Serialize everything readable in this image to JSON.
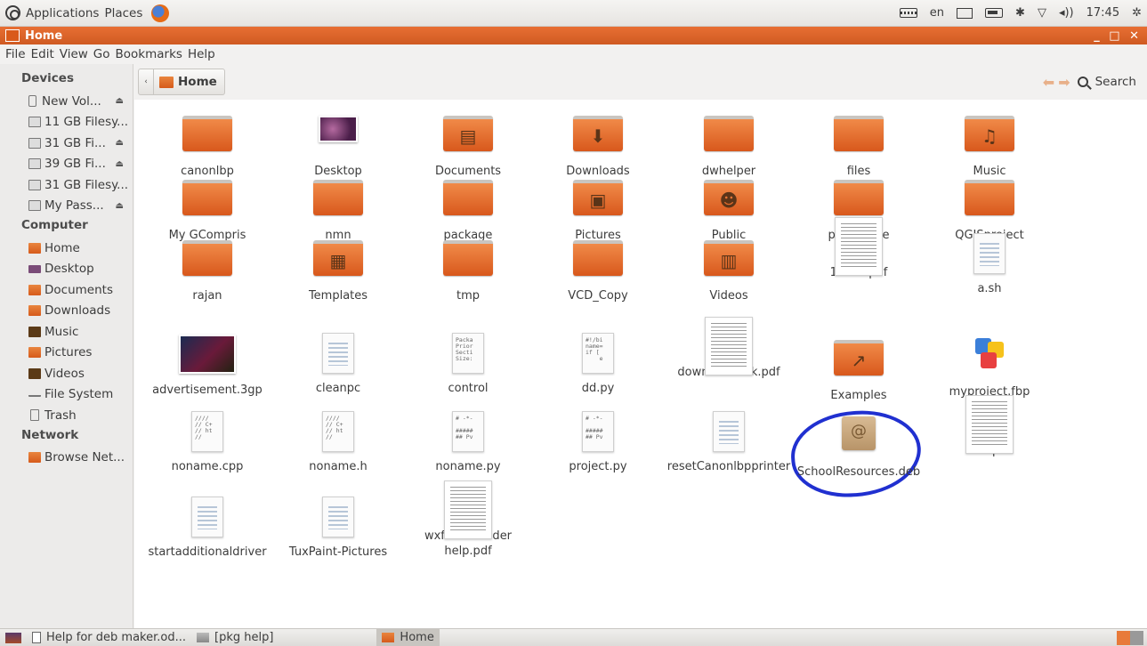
{
  "top_panel": {
    "menus": [
      "Applications",
      "Places"
    ],
    "indicators": {
      "keyboard_layout": "en",
      "time": "17:45"
    }
  },
  "window": {
    "title": "Home",
    "controls": "_ □ ✕"
  },
  "menu_bar": [
    "File",
    "Edit",
    "View",
    "Go",
    "Bookmarks",
    "Help"
  ],
  "sidebar": {
    "sections": [
      {
        "heading": "Devices",
        "items": [
          {
            "label": "New Vol...",
            "icon": "usb-drive-icon",
            "eject": true
          },
          {
            "label": "11 GB Filesy...",
            "icon": "hard-disk-icon",
            "eject": false
          },
          {
            "label": "31 GB Fi...",
            "icon": "hard-disk-icon",
            "eject": true
          },
          {
            "label": "39 GB Fi...",
            "icon": "hard-disk-icon",
            "eject": true
          },
          {
            "label": "31 GB Filesy...",
            "icon": "hard-disk-icon",
            "eject": false
          },
          {
            "label": "My Pass...",
            "icon": "external-drive-icon",
            "eject": true
          }
        ]
      },
      {
        "heading": "Computer",
        "items": [
          {
            "label": "Home",
            "icon": "home-folder-icon"
          },
          {
            "label": "Desktop",
            "icon": "desktop-icon"
          },
          {
            "label": "Documents",
            "icon": "documents-folder-icon"
          },
          {
            "label": "Downloads",
            "icon": "downloads-folder-icon"
          },
          {
            "label": "Music",
            "icon": "music-folder-icon"
          },
          {
            "label": "Pictures",
            "icon": "pictures-folder-icon"
          },
          {
            "label": "Videos",
            "icon": "videos-folder-icon"
          },
          {
            "label": "File System",
            "icon": "file-system-icon"
          },
          {
            "label": "Trash",
            "icon": "trash-icon"
          }
        ]
      },
      {
        "heading": "Network",
        "items": [
          {
            "label": "Browse Net...",
            "icon": "network-icon"
          }
        ]
      }
    ]
  },
  "toolbar": {
    "path_button": "Home",
    "search_label": "Search"
  },
  "files": [
    {
      "name": "canonlbp",
      "kind": "folder"
    },
    {
      "name": "Desktop",
      "kind": "desktop"
    },
    {
      "name": "Documents",
      "kind": "folder",
      "emblem": "▤"
    },
    {
      "name": "Downloads",
      "kind": "folder",
      "emblem": "⬇"
    },
    {
      "name": "dwhelper",
      "kind": "folder"
    },
    {
      "name": "files",
      "kind": "folder"
    },
    {
      "name": "Music",
      "kind": "folder",
      "emblem": "♫"
    },
    {
      "name": "My GCompris",
      "kind": "folder"
    },
    {
      "name": "nmn",
      "kind": "folder"
    },
    {
      "name": "package",
      "kind": "folder"
    },
    {
      "name": "Pictures",
      "kind": "folder",
      "emblem": "▣"
    },
    {
      "name": "Public",
      "kind": "folder",
      "emblem": "☻"
    },
    {
      "name": "pysycache",
      "kind": "folder"
    },
    {
      "name": "QGISproject",
      "kind": "folder"
    },
    {
      "name": "rajan",
      "kind": "folder"
    },
    {
      "name": "Templates",
      "kind": "folder",
      "emblem": "▦"
    },
    {
      "name": "tmp",
      "kind": "folder"
    },
    {
      "name": "VCD_Copy",
      "kind": "folder"
    },
    {
      "name": "Videos",
      "kind": "folder",
      "emblem": "▥"
    },
    {
      "name": "12link.pdf",
      "kind": "pdf"
    },
    {
      "name": "a.sh",
      "kind": "text"
    },
    {
      "name": "advertisement.3gp",
      "kind": "video"
    },
    {
      "name": "cleanpc",
      "kind": "text"
    },
    {
      "name": "control",
      "kind": "code",
      "preview": "Packa\nPrior\nSecti\nSize:"
    },
    {
      "name": "dd.py",
      "kind": "code",
      "preview": "#!/bi\nname=\nif [\n    e"
    },
    {
      "name": "download link.pdf",
      "kind": "pdf"
    },
    {
      "name": "Examples",
      "kind": "folder",
      "emblem": "↗"
    },
    {
      "name": "myproject.fbp",
      "kind": "wxfb"
    },
    {
      "name": "noname.cpp",
      "kind": "code",
      "preview": "////\n// C+\n// ht\n//"
    },
    {
      "name": "noname.h",
      "kind": "code",
      "preview": "////\n// C+\n// ht\n//"
    },
    {
      "name": "noname.py",
      "kind": "code",
      "preview": "# -*-\n\n#####\n## Pv"
    },
    {
      "name": "project.py",
      "kind": "code",
      "preview": "# -*-\n\n#####\n## Pv"
    },
    {
      "name": "resetCanonlbpprinter",
      "kind": "text"
    },
    {
      "name": "SchoolResources.deb",
      "kind": "package"
    },
    {
      "name": "sed.pdf",
      "kind": "pdf"
    },
    {
      "name": "startadditionaldriver",
      "kind": "text"
    },
    {
      "name": "TuxPaint-Pictures",
      "kind": "locked"
    },
    {
      "name": "wxform builder help.pdf",
      "kind": "pdf"
    }
  ],
  "taskbar": [
    {
      "label": "Help for deb maker.od...",
      "icon": "document-icon",
      "active": false
    },
    {
      "label": "[pkg help]",
      "icon": "folder-icon",
      "active": false
    },
    {
      "label": "Home",
      "icon": "home-folder-icon",
      "active": true
    }
  ],
  "colors": {
    "accent": "#dd6627",
    "folder": "#e4733a",
    "highlight_ring": "#2030d0"
  }
}
